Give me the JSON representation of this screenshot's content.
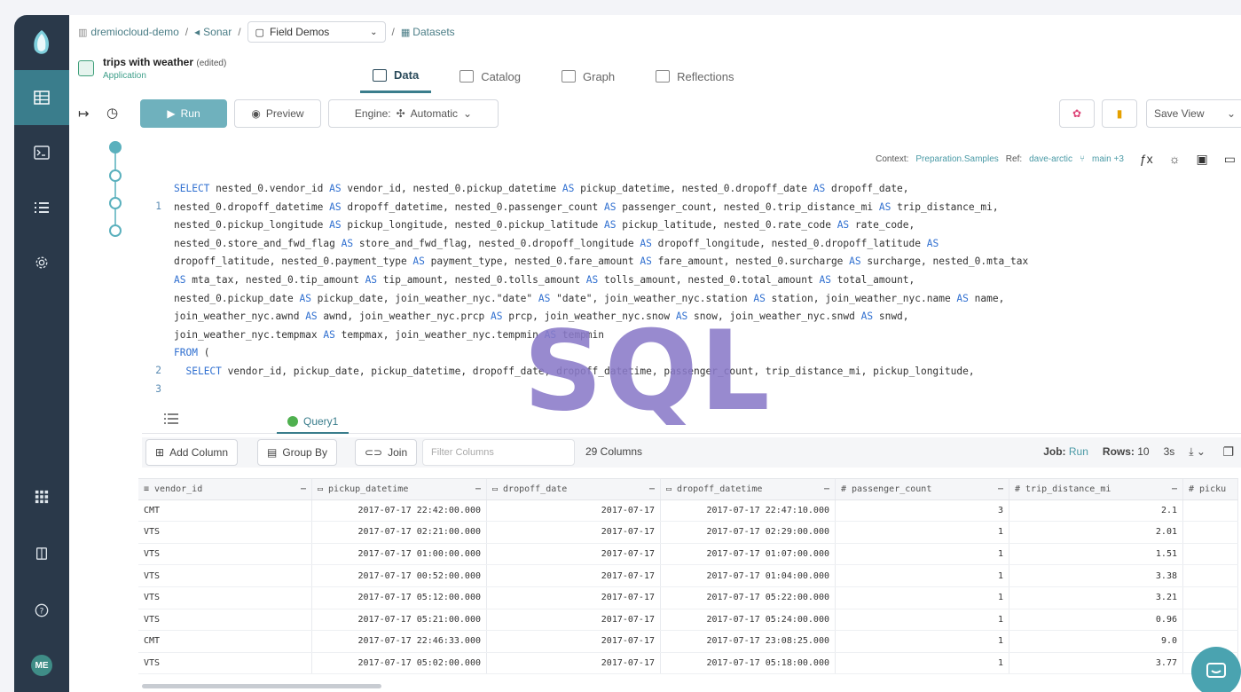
{
  "breadcrumbs": {
    "space": "dremiocloud-demo",
    "source": "Sonar",
    "folder": "Field Demos",
    "section": "Datasets"
  },
  "dataset": {
    "title": "trips with weather",
    "edited": "(edited)",
    "type": "Application"
  },
  "tabs": [
    {
      "label": "Data",
      "active": true
    },
    {
      "label": "Catalog",
      "active": false
    },
    {
      "label": "Graph",
      "active": false
    },
    {
      "label": "Reflections",
      "active": false
    }
  ],
  "toolbar": {
    "run": "Run",
    "preview": "Preview",
    "engine_label": "Engine:",
    "engine_value": "Automatic",
    "save_view": "Save View"
  },
  "context": {
    "context_label": "Context:",
    "context_value": "Preparation.Samples",
    "ref_label": "Ref:",
    "ref_value": "dave-arctic",
    "branch": "main +3"
  },
  "sql": {
    "line_numbers": [
      "1",
      "2",
      "3"
    ],
    "lines": [
      "SELECT nested_0.vendor_id AS vendor_id, nested_0.pickup_datetime AS pickup_datetime, nested_0.dropoff_date AS dropoff_date,",
      "nested_0.dropoff_datetime AS dropoff_datetime, nested_0.passenger_count AS passenger_count, nested_0.trip_distance_mi AS trip_distance_mi,",
      "nested_0.pickup_longitude AS pickup_longitude, nested_0.pickup_latitude AS pickup_latitude, nested_0.rate_code AS rate_code,",
      "nested_0.store_and_fwd_flag AS store_and_fwd_flag, nested_0.dropoff_longitude AS dropoff_longitude, nested_0.dropoff_latitude AS",
      "dropoff_latitude, nested_0.payment_type AS payment_type, nested_0.fare_amount AS fare_amount, nested_0.surcharge AS surcharge, nested_0.mta_tax",
      "AS mta_tax, nested_0.tip_amount AS tip_amount, nested_0.tolls_amount AS tolls_amount, nested_0.total_amount AS total_amount,",
      "nested_0.pickup_date AS pickup_date, join_weather_nyc.\"date\" AS \"date\", join_weather_nyc.station AS station, join_weather_nyc.name AS name,",
      "join_weather_nyc.awnd AS awnd, join_weather_nyc.prcp AS prcp, join_weather_nyc.snow AS snow, join_weather_nyc.snwd AS snwd,",
      "join_weather_nyc.tempmax AS tempmax, join_weather_nyc.tempmin AS tempmin",
      "FROM (",
      "  SELECT vendor_id, pickup_date, pickup_datetime, dropoff_date, dropoff_datetime, passenger_count, trip_distance_mi, pickup_longitude,"
    ]
  },
  "watermark": "SQL",
  "results": {
    "query_tab": "Query1",
    "add_column": "Add Column",
    "group_by": "Group By",
    "join": "Join",
    "filter_placeholder": "Filter Columns",
    "column_count": "29 Columns",
    "job_label": "Job:",
    "job_value": "Run",
    "rows_label": "Rows:",
    "rows_value": "10",
    "duration": "3s",
    "columns": [
      "vendor_id",
      "pickup_datetime",
      "dropoff_date",
      "dropoff_datetime",
      "passenger_count",
      "trip_distance_mi",
      "picku"
    ],
    "rows": [
      [
        "CMT",
        "2017-07-17 22:42:00.000",
        "2017-07-17",
        "2017-07-17 22:47:10.000",
        "3",
        "2.1"
      ],
      [
        "VTS",
        "2017-07-17 02:21:00.000",
        "2017-07-17",
        "2017-07-17 02:29:00.000",
        "1",
        "2.01"
      ],
      [
        "VTS",
        "2017-07-17 01:00:00.000",
        "2017-07-17",
        "2017-07-17 01:07:00.000",
        "1",
        "1.51"
      ],
      [
        "VTS",
        "2017-07-17 00:52:00.000",
        "2017-07-17",
        "2017-07-17 01:04:00.000",
        "1",
        "3.38"
      ],
      [
        "VTS",
        "2017-07-17 05:12:00.000",
        "2017-07-17",
        "2017-07-17 05:22:00.000",
        "1",
        "3.21"
      ],
      [
        "VTS",
        "2017-07-17 05:21:00.000",
        "2017-07-17",
        "2017-07-17 05:24:00.000",
        "1",
        "0.96"
      ],
      [
        "CMT",
        "2017-07-17 22:46:33.000",
        "2017-07-17",
        "2017-07-17 23:08:25.000",
        "1",
        "9.0"
      ],
      [
        "VTS",
        "2017-07-17 05:02:00.000",
        "2017-07-17",
        "2017-07-17 05:18:00.000",
        "1",
        "3.77"
      ]
    ]
  },
  "user": {
    "initials": "ME"
  },
  "colors": {
    "sidebar": "#2a394a",
    "accent": "#3a7d8c",
    "keyword": "#2f6fd0",
    "watermark": "#8a7ac8"
  }
}
